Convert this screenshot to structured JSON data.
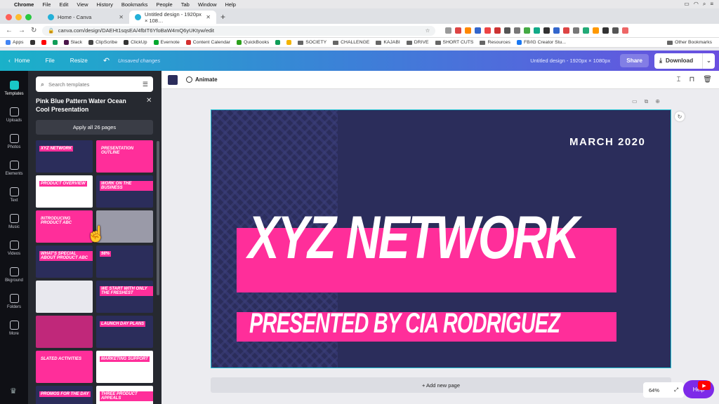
{
  "macos_menu": {
    "app": "Chrome",
    "items": [
      "File",
      "Edit",
      "View",
      "History",
      "Bookmarks",
      "People",
      "Tab",
      "Window",
      "Help"
    ]
  },
  "browser": {
    "tabs": [
      {
        "title": "Home - Canva",
        "active": false
      },
      {
        "title": "Untitled design - 1920px × 108…",
        "active": true
      }
    ],
    "url": "canva.com/design/DAEHt1sqsEA/4fbIT6YfoBaW4mQ6yUKtyw/edit",
    "bookmarks": [
      {
        "label": "Apps",
        "type": "apps"
      },
      {
        "label": "",
        "type": "icon",
        "color": "#333333"
      },
      {
        "label": "",
        "type": "icon",
        "color": "#ff0000"
      },
      {
        "label": "",
        "type": "icon",
        "color": "#0f9d58"
      },
      {
        "label": "Slack",
        "type": "icon",
        "color": "#4a154b"
      },
      {
        "label": "ClipScribe",
        "type": "icon",
        "color": "#444444"
      },
      {
        "label": "ClickUp",
        "type": "icon",
        "color": "#333333"
      },
      {
        "label": "Evernote",
        "type": "icon",
        "color": "#00a82d"
      },
      {
        "label": "Content Calendar",
        "type": "icon",
        "color": "#d42f2f"
      },
      {
        "label": "QuickBooks",
        "type": "icon",
        "color": "#2ca01c"
      },
      {
        "label": "",
        "type": "icon",
        "color": "#0f9d58"
      },
      {
        "label": "",
        "type": "icon",
        "color": "#f4b400"
      },
      {
        "label": "SOCIETY",
        "type": "folder"
      },
      {
        "label": "CHALLENGE",
        "type": "folder"
      },
      {
        "label": "KAJABI",
        "type": "folder"
      },
      {
        "label": "DRIVE",
        "type": "folder"
      },
      {
        "label": "SHORT CUTS",
        "type": "folder"
      },
      {
        "label": "Resources",
        "type": "folder"
      },
      {
        "label": "FB/IG Creator Stu...",
        "type": "icon",
        "color": "#1877f2"
      }
    ],
    "other_bookmarks": "Other Bookmarks"
  },
  "canva_header": {
    "home": "Home",
    "file": "File",
    "resize": "Resize",
    "unsaved": "Unsaved changes",
    "design_title": "Untitled design - 1920px × 1080px",
    "share": "Share",
    "download": "Download"
  },
  "siderail": [
    {
      "label": "Templates",
      "active": true
    },
    {
      "label": "Uploads",
      "active": false
    },
    {
      "label": "Photos",
      "active": false
    },
    {
      "label": "Elements",
      "active": false
    },
    {
      "label": "Text",
      "active": false
    },
    {
      "label": "Music",
      "active": false
    },
    {
      "label": "Videos",
      "active": false
    },
    {
      "label": "Bkground",
      "active": false
    },
    {
      "label": "Folders",
      "active": false
    },
    {
      "label": "More",
      "active": false
    }
  ],
  "panel": {
    "search_placeholder": "Search templates",
    "title": "Pink Blue Pattern Water Ocean Cool Presentation",
    "apply_button": "Apply all 26 pages",
    "thumbnails": [
      {
        "text": "XYZ NETWORK",
        "bg": "#2b2d5b"
      },
      {
        "text": "PRESENTATION OUTLINE",
        "bg": "#ff2e9a"
      },
      {
        "text": "PRODUCT OVERVIEW",
        "bg": "#ffffff"
      },
      {
        "text": "WORK ON THE BUSINESS",
        "bg": "#2b2d5b"
      },
      {
        "text": "INTRODUCING PRODUCT ABC",
        "bg": "#ff2e9a"
      },
      {
        "text": "",
        "bg": "#9a9aa8"
      },
      {
        "text": "WHAT'S SPECIAL ABOUT PRODUCT ABC",
        "bg": "#2b2d5b"
      },
      {
        "text": "98%",
        "bg": "#2b2d5b"
      },
      {
        "text": "",
        "bg": "#e8e8ee"
      },
      {
        "text": "WE START WITH ONLY THE FRESHEST",
        "bg": "#2b2d5b"
      },
      {
        "text": "",
        "bg": "#c0287a"
      },
      {
        "text": "LAUNCH DAY PLANS",
        "bg": "#2b2d5b"
      },
      {
        "text": "SLATED ACTIVITIES",
        "bg": "#ff2e9a"
      },
      {
        "text": "MARKETING SUPPORT",
        "bg": "#ffffff"
      },
      {
        "text": "PROMOS FOR THE DAY",
        "bg": "#2b2d5b"
      },
      {
        "text": "THREE PRODUCT APPEALS",
        "bg": "#ffffff"
      }
    ]
  },
  "editor": {
    "animate": "Animate",
    "add_page": "+ Add new page",
    "zoom": "64%",
    "help": "Help"
  },
  "design": {
    "date": "MARCH 2020",
    "headline": "XYZ NETWORK",
    "subtitle": "PRESENTED BY CIA RODRIGUEZ",
    "colors": {
      "navy": "#2b2d5b",
      "pink": "#ff2e9a"
    }
  }
}
